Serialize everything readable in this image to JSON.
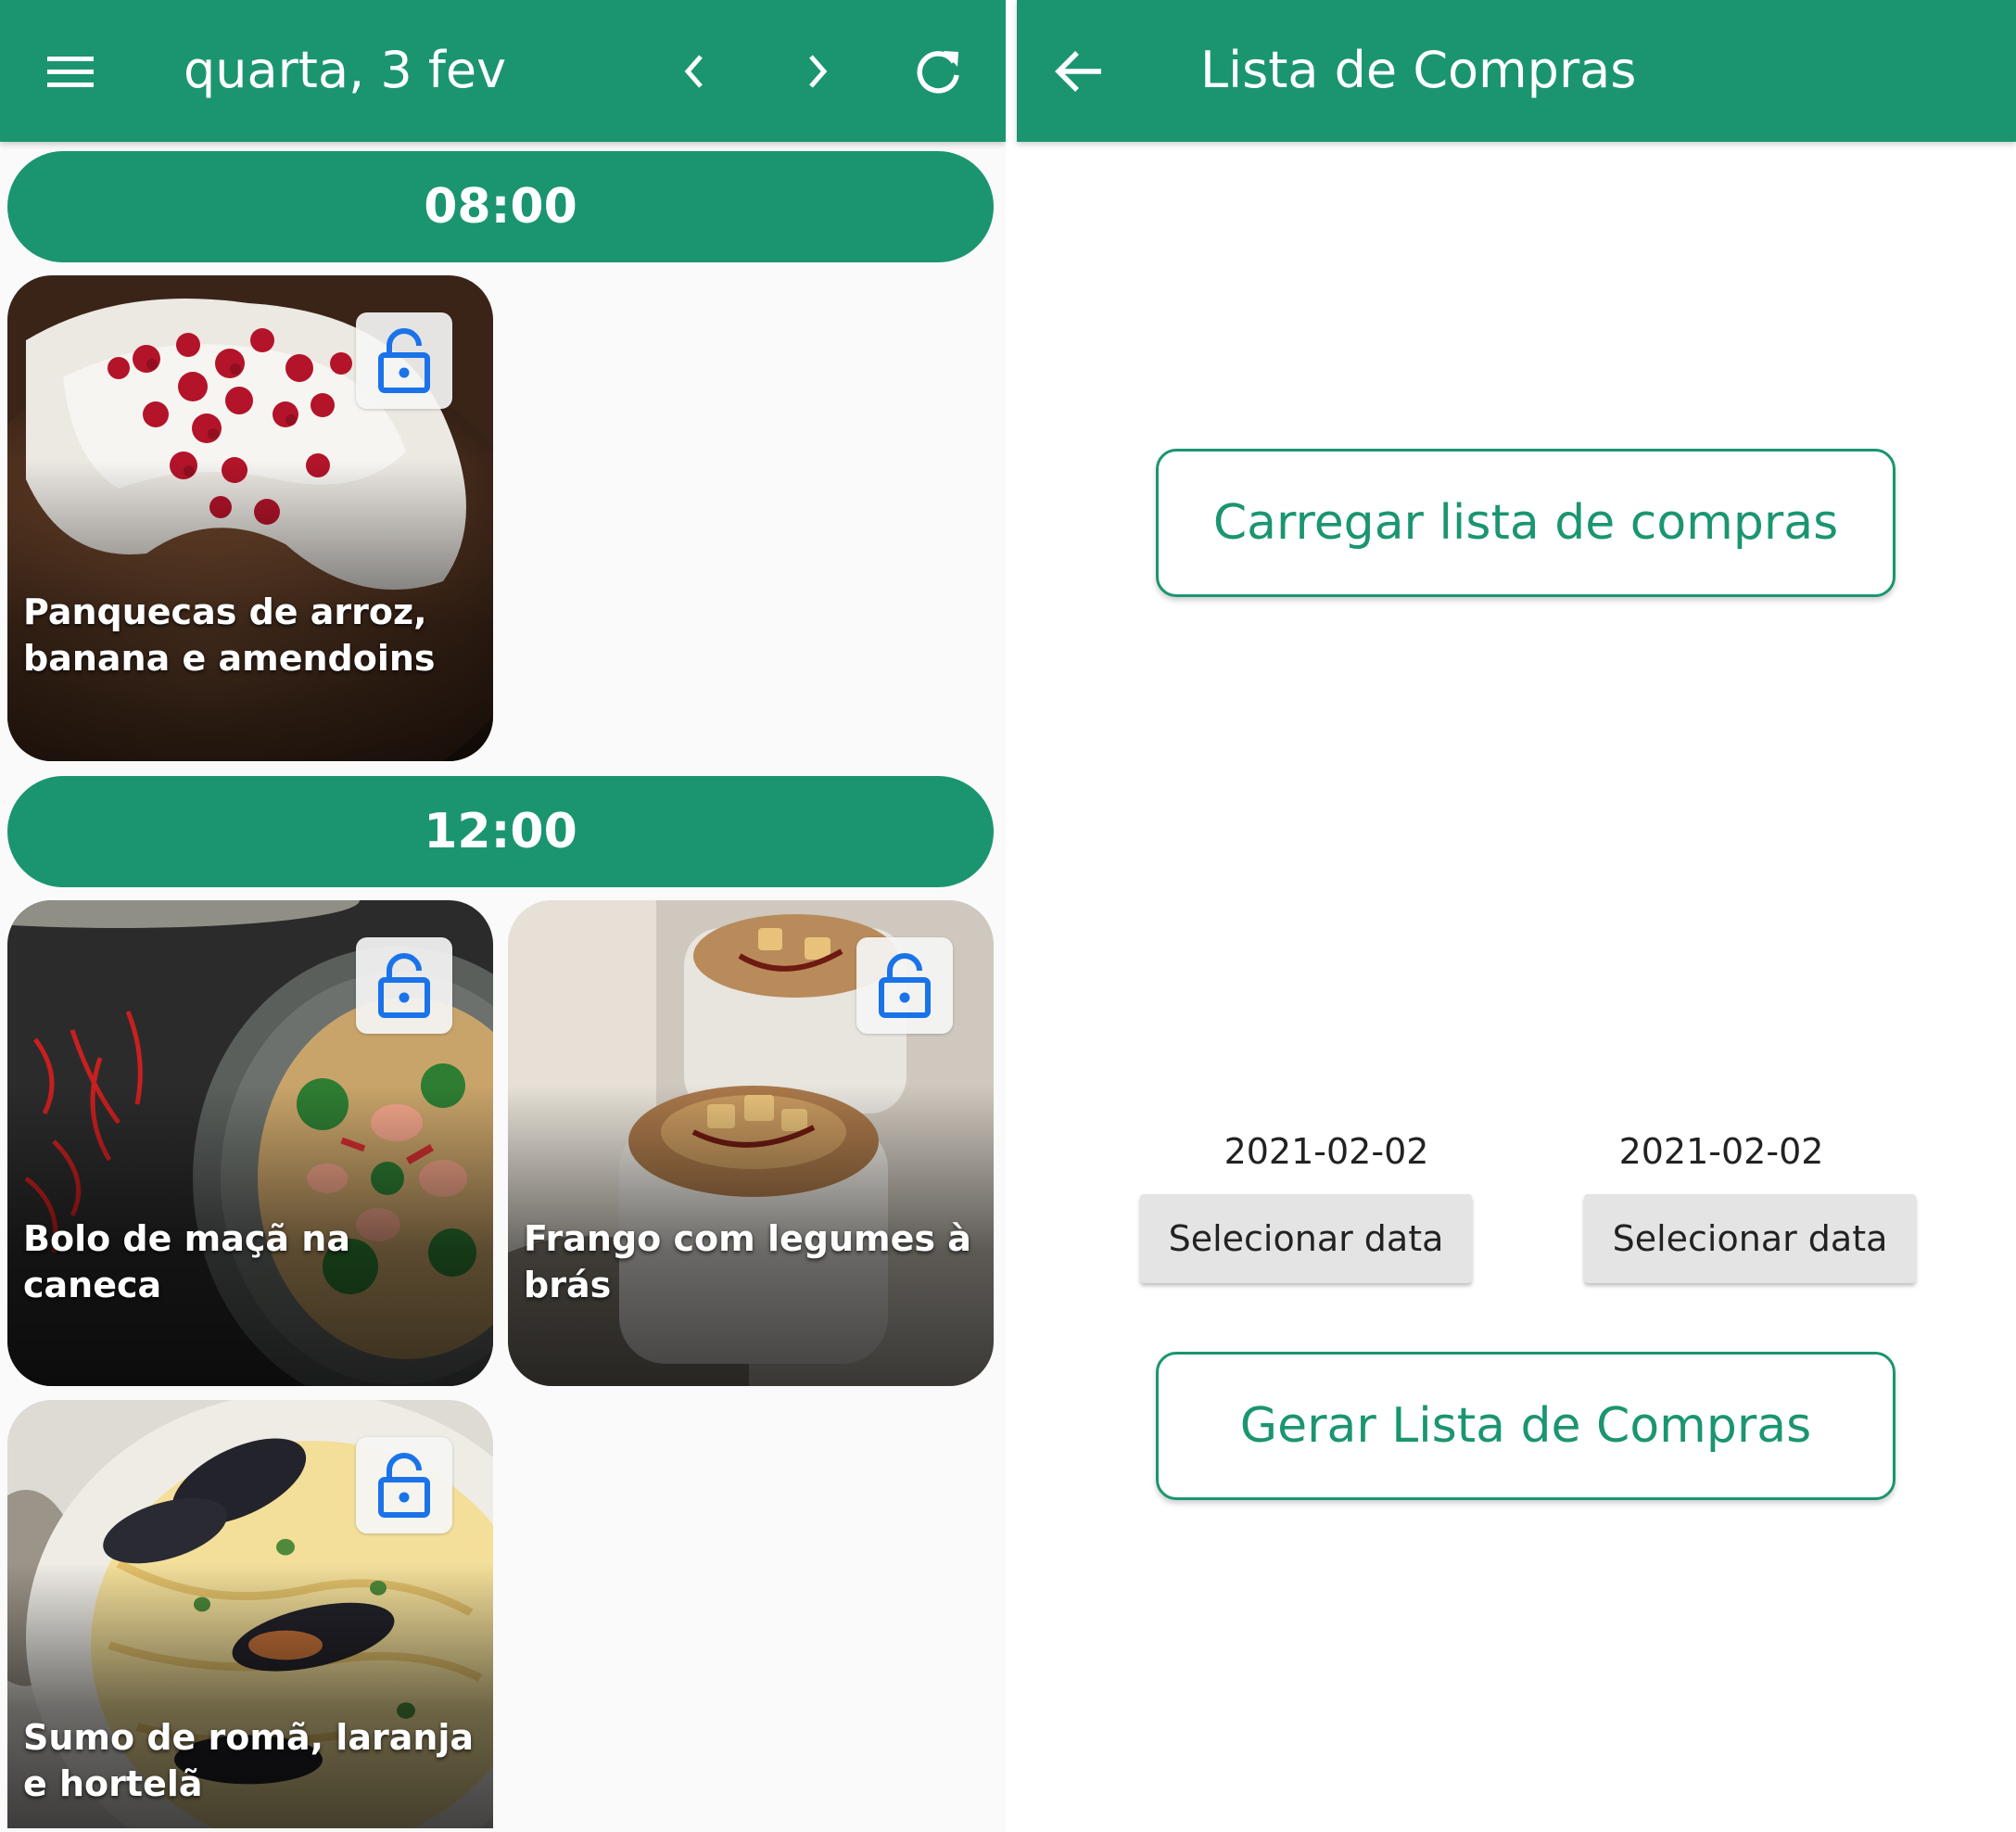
{
  "planner": {
    "title": "quarta, 3 fev",
    "icons": {
      "menu": "menu-icon",
      "previous": "chevron-left-icon",
      "next": "chevron-right-icon",
      "refresh": "refresh-icon"
    },
    "sections": [
      {
        "time": "08:00",
        "meals": [
          {
            "name": "Panquecas de arroz, banana e amendoins",
            "icon": "lock-open-icon"
          }
        ]
      },
      {
        "time": "12:00",
        "meals": [
          {
            "name": "Bolo de maçã na caneca",
            "icon": "lock-open-icon"
          },
          {
            "name": "Frango com legumes à brás",
            "icon": "lock-open-icon"
          },
          {
            "name": "Sumo de romã, laranja e hortelã",
            "icon": "lock-open-icon"
          }
        ]
      }
    ]
  },
  "shopping": {
    "title": "Lista de Compras",
    "back_icon": "arrow-back-icon",
    "load_button": "Carregar lista de compras",
    "start_date": "2021-02-02",
    "end_date": "2021-02-02",
    "select_date_label": "Selecionar data",
    "generate_button": "Gerar Lista de Compras"
  },
  "colors": {
    "primary": "#1b9570",
    "lock_icon": "#1a73e8",
    "background": "#fafafa",
    "date_button": "#e4e4e4"
  }
}
